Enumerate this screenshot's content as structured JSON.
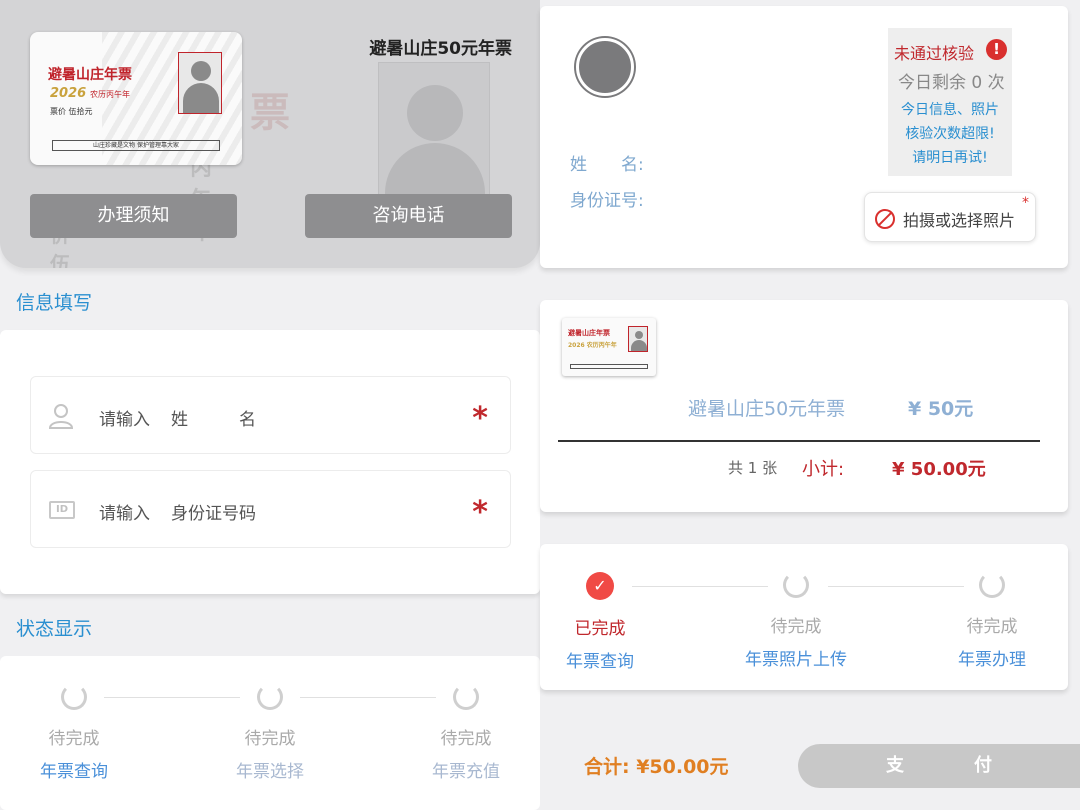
{
  "hero": {
    "title": "避暑山庄50元年票",
    "ticket": {
      "name": "避暑山庄年票",
      "year": "2026",
      "lunar": "农历丙午年",
      "price_line": "票价  伍拾元",
      "slogan": "山庄珍藏是文物   保护管理靠大家"
    },
    "ghost_text": [
      "票",
      "丙午年",
      "票价  伍拾元"
    ],
    "buttons": [
      {
        "label": "办理须知"
      },
      {
        "label": "咨询电话"
      }
    ]
  },
  "form": {
    "section_title": "信息填写",
    "fields": [
      {
        "prefix": "请输入",
        "name": "姓　　　名",
        "required": "*",
        "icon": "person-icon"
      },
      {
        "prefix": "请输入",
        "name": "身份证号码",
        "required": "*",
        "icon": "id-card-icon",
        "icon_text": "ID"
      }
    ]
  },
  "status": {
    "section_title": "状态显示",
    "steps": [
      {
        "state": "待完成",
        "label": "年票查询"
      },
      {
        "state": "待完成",
        "label": "年票选择"
      },
      {
        "state": "待完成",
        "label": "年票充值"
      }
    ]
  },
  "info": {
    "name_label": "姓　　名:",
    "id_label": "身份证号:",
    "verify": {
      "status": "未通过核验",
      "alert_icon": "!",
      "remaining": "今日剩余 0 次",
      "message_lines": [
        "今日信息、照片",
        "核验次数超限!",
        "请明日再试!"
      ]
    },
    "upload_button": "拍摄或选择照片",
    "upload_star": "*"
  },
  "order": {
    "mini_ticket": {
      "name": "避暑山庄年票",
      "year": "2026 农历丙午年"
    },
    "product_name": "避暑山庄50元年票",
    "product_price": "¥ 50元",
    "count": "共 1 张",
    "subtotal_label": "小计:",
    "subtotal_value": "¥ 50.00元"
  },
  "progress": {
    "done_icon": "✓",
    "steps": [
      {
        "state": "已完成",
        "label": "年票查询"
      },
      {
        "state": "待完成",
        "label": "年票照片上传"
      },
      {
        "state": "待完成",
        "label": "年票办理"
      }
    ]
  },
  "footer": {
    "total": "合计: ¥50.00元",
    "pay_button": "支付"
  },
  "colors": {
    "accent_blue": "#2a8fd0",
    "alert_red": "#c0282d",
    "total_orange": "#e07f22"
  }
}
